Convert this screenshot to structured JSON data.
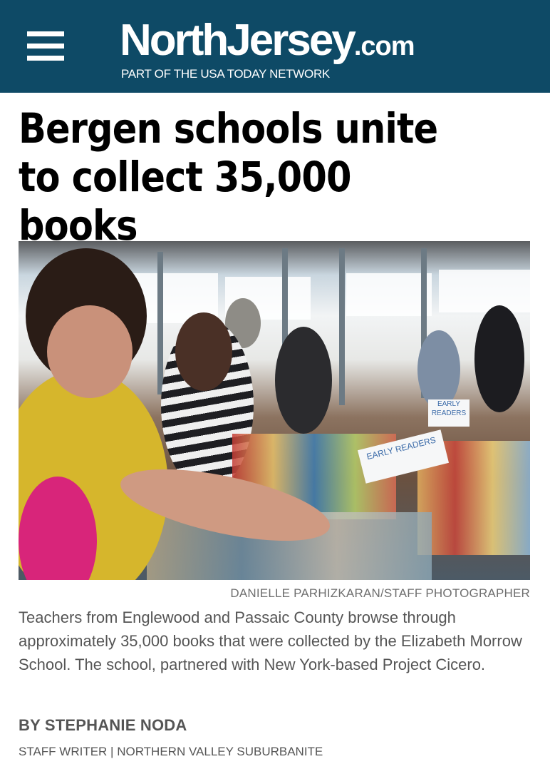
{
  "header": {
    "menu_icon": "hamburger-menu-icon",
    "logo": {
      "main": "NorthJersey",
      "tld": ".com"
    },
    "tagline": "PART OF THE USA TODAY NETWORK",
    "background_color": "#0e4a66"
  },
  "article": {
    "headline": "Bergen schools unite to collect 35,000 books",
    "photo": {
      "sign_labels": [
        "EARLY READERS",
        "EARLY READERS"
      ],
      "credit": "DANIELLE PARHIZKARAN/STAFF PHOTOGRAPHER"
    },
    "caption": "Teachers from Englewood and Passaic County browse through approximately 35,000 books that were collected by the Elizabeth Morrow School. The school, partnered with New York-based Project Cicero.",
    "byline": "BY STEPHANIE NODA",
    "author_role": "STAFF WRITER | NORTHERN VALLEY SUBURBANITE"
  }
}
